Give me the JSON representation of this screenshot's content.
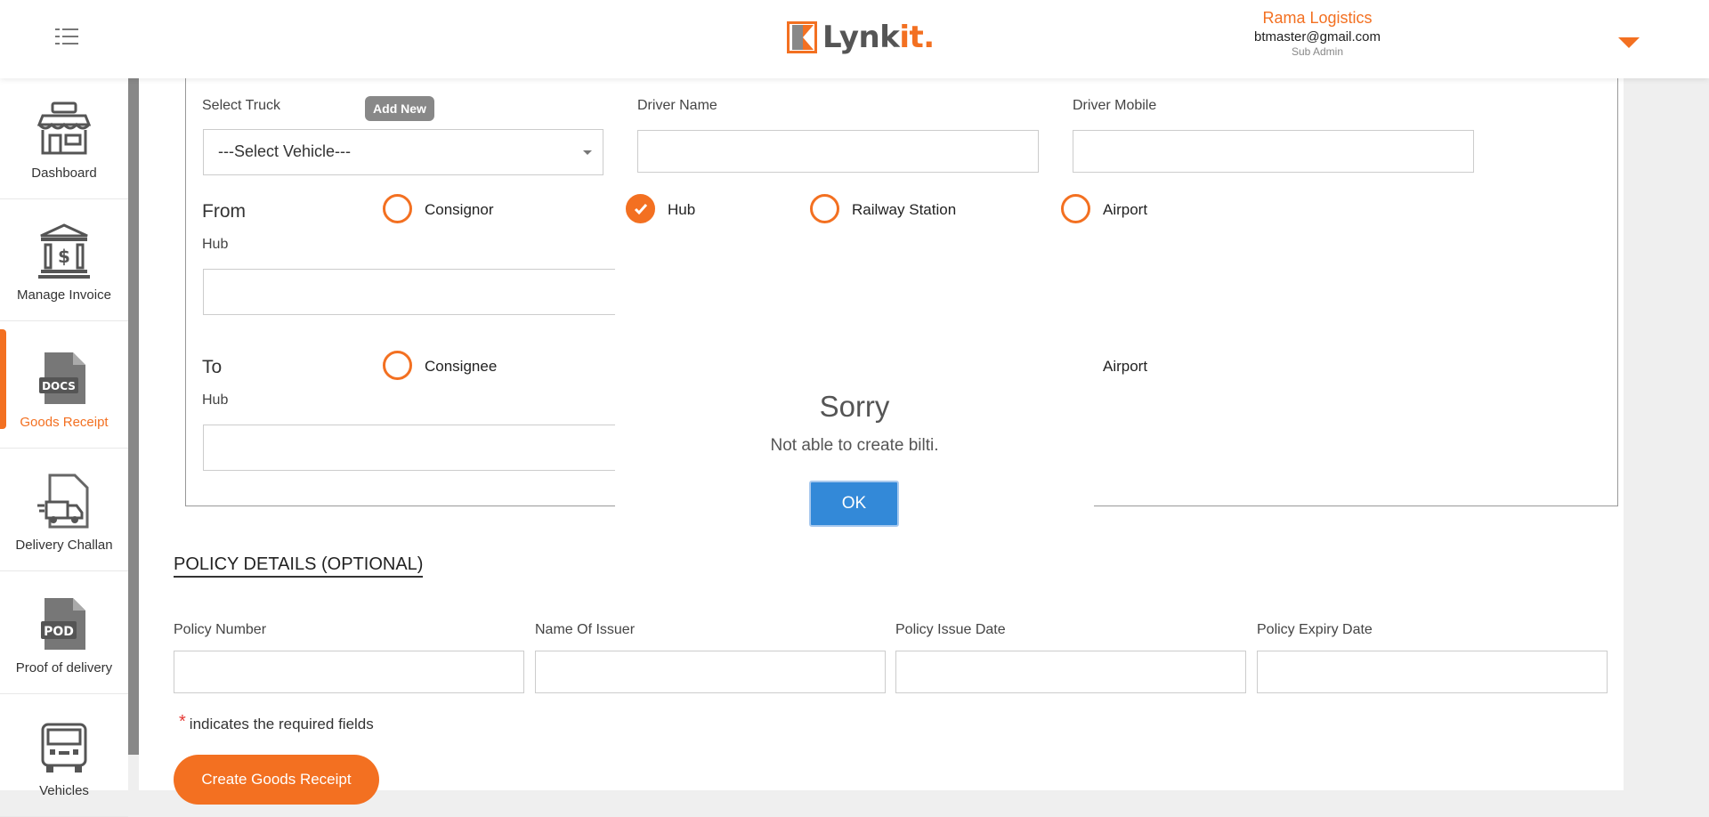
{
  "header": {
    "logo_text": "Lynk",
    "logo_accent": "it.",
    "company": "Rama Logistics",
    "email": "btmaster@gmail.com",
    "role": "Sub Admin"
  },
  "sidebar": {
    "items": [
      {
        "label": "Dashboard",
        "icon": "shop-icon"
      },
      {
        "label": "Manage Invoice",
        "icon": "bank-icon"
      },
      {
        "label": "Goods Receipt",
        "icon": "docs-icon",
        "icon_text": "DOCS",
        "active": true
      },
      {
        "label": "Delivery Challan",
        "icon": "delivery-truck-icon"
      },
      {
        "label": "Proof of delivery",
        "icon": "pod-icon",
        "icon_text": "POD"
      },
      {
        "label": "Vehicles",
        "icon": "bus-icon"
      }
    ]
  },
  "form": {
    "select_truck_label": "Select Truck",
    "add_new_label": "Add New",
    "vehicle_placeholder": "---Select Vehicle---",
    "driver_name_label": "Driver Name",
    "driver_mobile_label": "Driver Mobile",
    "from_label": "From",
    "from_options": [
      "Consignor",
      "Hub",
      "Railway Station",
      "Airport"
    ],
    "from_selected": "Hub",
    "from_hub_label": "Hub",
    "to_label": "To",
    "to_options_visible": [
      "Consignee",
      "Airport"
    ],
    "to_hub_label": "Hub"
  },
  "policy": {
    "title": "POLICY DETAILS (OPTIONAL)",
    "policy_number_label": "Policy Number",
    "issuer_label": "Name Of Issuer",
    "issue_date_label": "Policy Issue Date",
    "expiry_date_label": "Policy Expiry Date"
  },
  "required_note": {
    "star": "*",
    "text": "indicates the required fields"
  },
  "create_button": "Create Goods Receipt",
  "dialog": {
    "title": "Sorry",
    "message": "Not able to create bilti.",
    "ok_label": "OK"
  },
  "colors": {
    "accent": "#f37021",
    "dialog_button": "#3389d8"
  }
}
